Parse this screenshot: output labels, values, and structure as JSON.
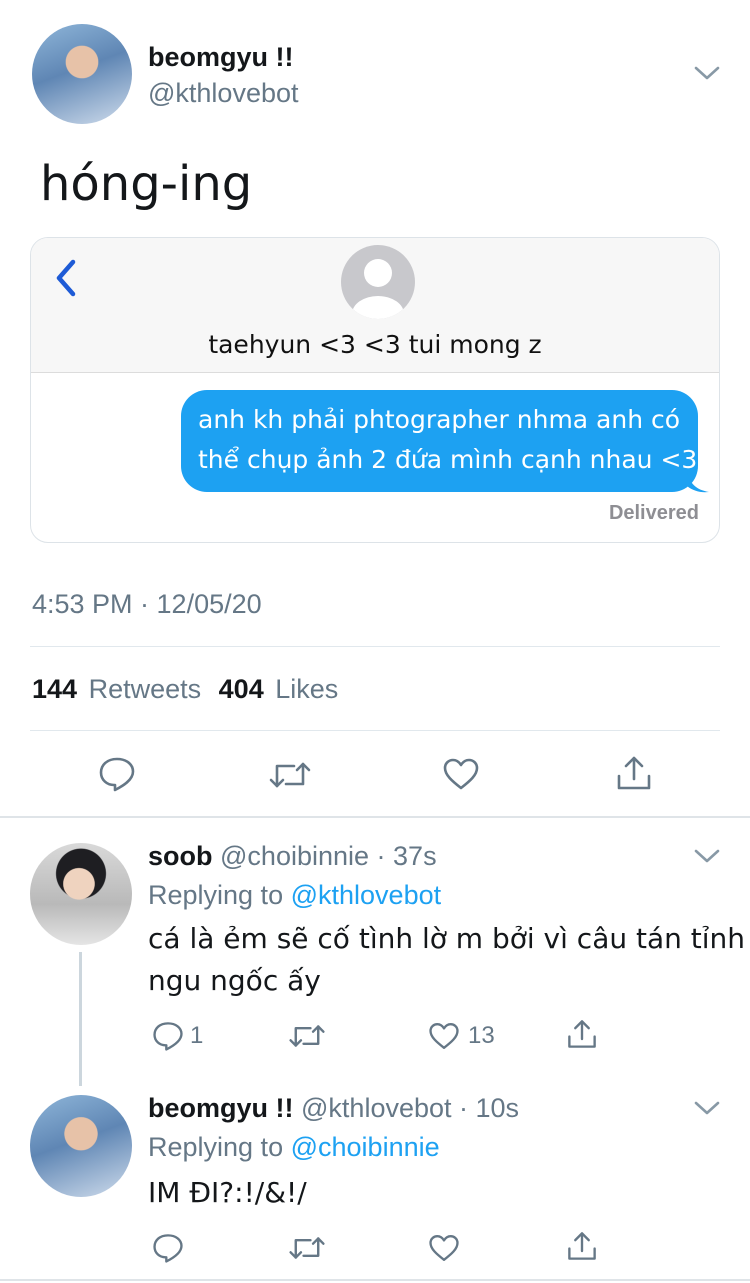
{
  "tweet": {
    "name": "beomgyu !!",
    "handle": "@kthlovebot",
    "text": "hóng-ing",
    "timestamp": "4:53 PM · 12/05/20",
    "retweets_count": "144",
    "retweets_label": "Retweets",
    "likes_count": "404",
    "likes_label": "Likes"
  },
  "imessage": {
    "contact": "taehyun <3 <3 tui mong z",
    "message_line1": "anh kh phải phtographer nhma anh có",
    "message_line2": "thể chụp ảnh 2 đứa mình cạnh nhau <3",
    "status": "Delivered"
  },
  "replies": [
    {
      "name": "soob",
      "handle": "@choibinnie",
      "time": "· 37s",
      "replying_label": "Replying to",
      "replying_to": "@kthlovebot",
      "text_line1": "cá là ẻm sẽ cố tình lờ m bởi vì câu tán tỉnh",
      "text_line2": "ngu ngốc ấy",
      "reply_count": "1",
      "like_count": "13"
    },
    {
      "name": "beomgyu !!",
      "handle": "@kthlovebot",
      "time": "· 10s",
      "replying_label": "Replying to",
      "replying_to": "@choibinnie",
      "text_line1": "IM ĐI?:!/&!/",
      "reply_count": "",
      "like_count": ""
    }
  ],
  "icons": [
    "chevron-down-icon",
    "back-chevron-icon",
    "contact-avatar-icon",
    "reply-icon",
    "retweet-icon",
    "like-icon",
    "share-icon"
  ],
  "colors": {
    "accent": "#1da1f2",
    "muted": "#657786",
    "imessage_back": "#1e5bd6"
  }
}
